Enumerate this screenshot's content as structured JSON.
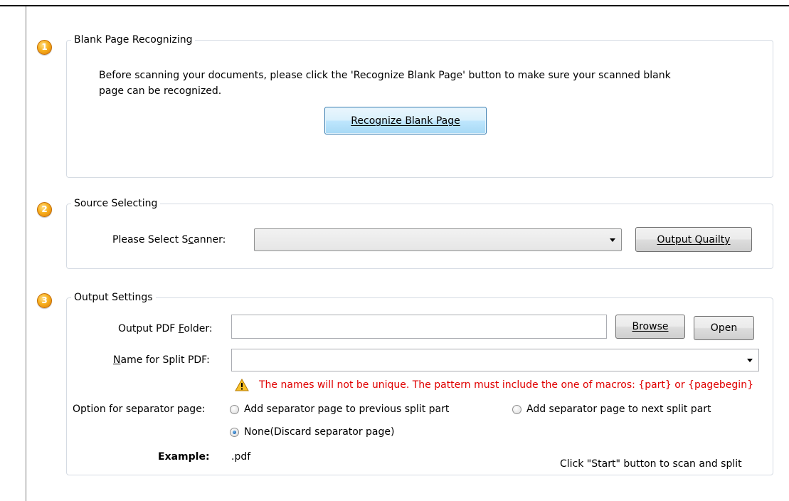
{
  "steps": [
    "1",
    "2",
    "3"
  ],
  "blank_page": {
    "legend": "Blank Page Recognizing",
    "description_line1": "Before scanning your documents, please click the 'Recognize Blank Page' button to make sure your scanned blank",
    "description_line2": "page can be recognized.",
    "button_label": "Recognize Blank Page"
  },
  "source": {
    "legend": "Source Selecting",
    "scanner_label_pre": "Please Select S",
    "scanner_label_key": "c",
    "scanner_label_post": "anner:",
    "scanner_value": "",
    "quality_button": "Output Quailty"
  },
  "output": {
    "legend": "Output Settings",
    "folder_label_pre": "Output PDF ",
    "folder_label_key": "F",
    "folder_label_post": "older:",
    "folder_value": "",
    "browse_button": "Browse",
    "open_button": "Open",
    "split_label_key": "N",
    "split_label_post": "ame for Split PDF:",
    "split_value": "",
    "warning": "The names will not be unique. The pattern must include the one of macros: {part} or {pagebegin}",
    "separator_label": "Option for separator page:",
    "options": [
      {
        "label": "Add separator page to previous split part",
        "checked": false
      },
      {
        "label": "Add separator page to next split part",
        "checked": false
      },
      {
        "label": "None(Discard separator page)",
        "checked": true
      }
    ],
    "example_label": "Example:",
    "example_value": ".pdf",
    "hint": "Click \"Start\" button to scan and split"
  },
  "icons": [
    "step-1-badge-icon",
    "step-2-badge-icon",
    "step-3-badge-icon",
    "warning-icon",
    "dropdown-arrow-icon"
  ],
  "colors": {
    "warning": "#e00000",
    "badge": "#f7b01f",
    "group_border": "#d5dbe3"
  }
}
